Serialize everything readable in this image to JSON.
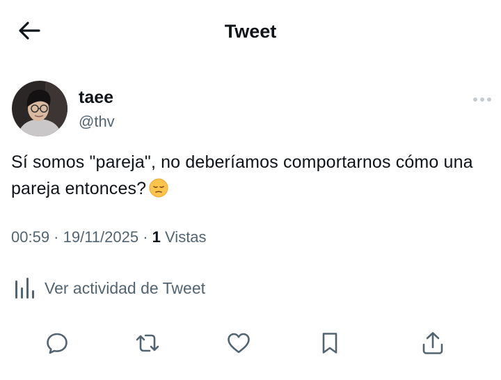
{
  "header": {
    "title": "Tweet",
    "back_icon": "arrow-left-icon"
  },
  "author": {
    "display_name": "taee",
    "handle": "@thv"
  },
  "tweet": {
    "text": "Sí somos \"pareja\", no deberíamos comportarnos cómo una pareja entonces?",
    "emoji": "pensive-face-emoji"
  },
  "meta": {
    "time": "00:59",
    "separator": " · ",
    "date": "19/11/2025",
    "views_count": "1",
    "views_label": " Vistas"
  },
  "activity": {
    "label": "Ver actividad de Tweet",
    "icon": "analytics-icon"
  },
  "actions": [
    "reply-icon",
    "retweet-icon",
    "like-icon",
    "bookmark-icon",
    "share-icon"
  ],
  "colors": {
    "text": "#0f1419",
    "secondary": "#536471"
  }
}
